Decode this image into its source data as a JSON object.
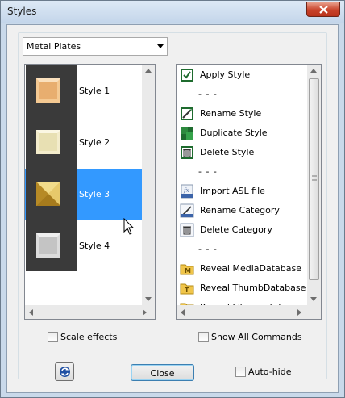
{
  "window": {
    "title": "Styles"
  },
  "dropdown": {
    "selected": "Metal Plates"
  },
  "styles": [
    {
      "label": "Style 1",
      "swatch": "#e8b37a",
      "selected": false
    },
    {
      "label": "Style 2",
      "swatch": "#ede6bb",
      "selected": false
    },
    {
      "label": "Style 3",
      "swatch": "#d9b24c",
      "selected": true
    },
    {
      "label": "Style 4",
      "swatch": "#c9c9c9",
      "selected": false
    }
  ],
  "commands": {
    "apply": "Apply Style",
    "sep1": "- - -",
    "rename_style": "Rename Style",
    "duplicate_style": "Duplicate Style",
    "delete_style": "Delete Style",
    "sep2": "- - -",
    "import_asl": "Import ASL file",
    "rename_category": "Rename Category",
    "delete_category": "Delete Category",
    "sep3": "- - -",
    "reveal_media": "Reveal MediaDatabase",
    "reveal_thumb": "Reveal ThumbDatabase",
    "reveal_partial": "Reveal Library.styles"
  },
  "options": {
    "scale_effects": "Scale effects",
    "show_all_commands": "Show All Commands",
    "auto_hide": "Auto-hide"
  },
  "buttons": {
    "close": "Close"
  },
  "colors": {
    "selection": "#3399ff",
    "thumb_background": "#3a3a3a"
  }
}
